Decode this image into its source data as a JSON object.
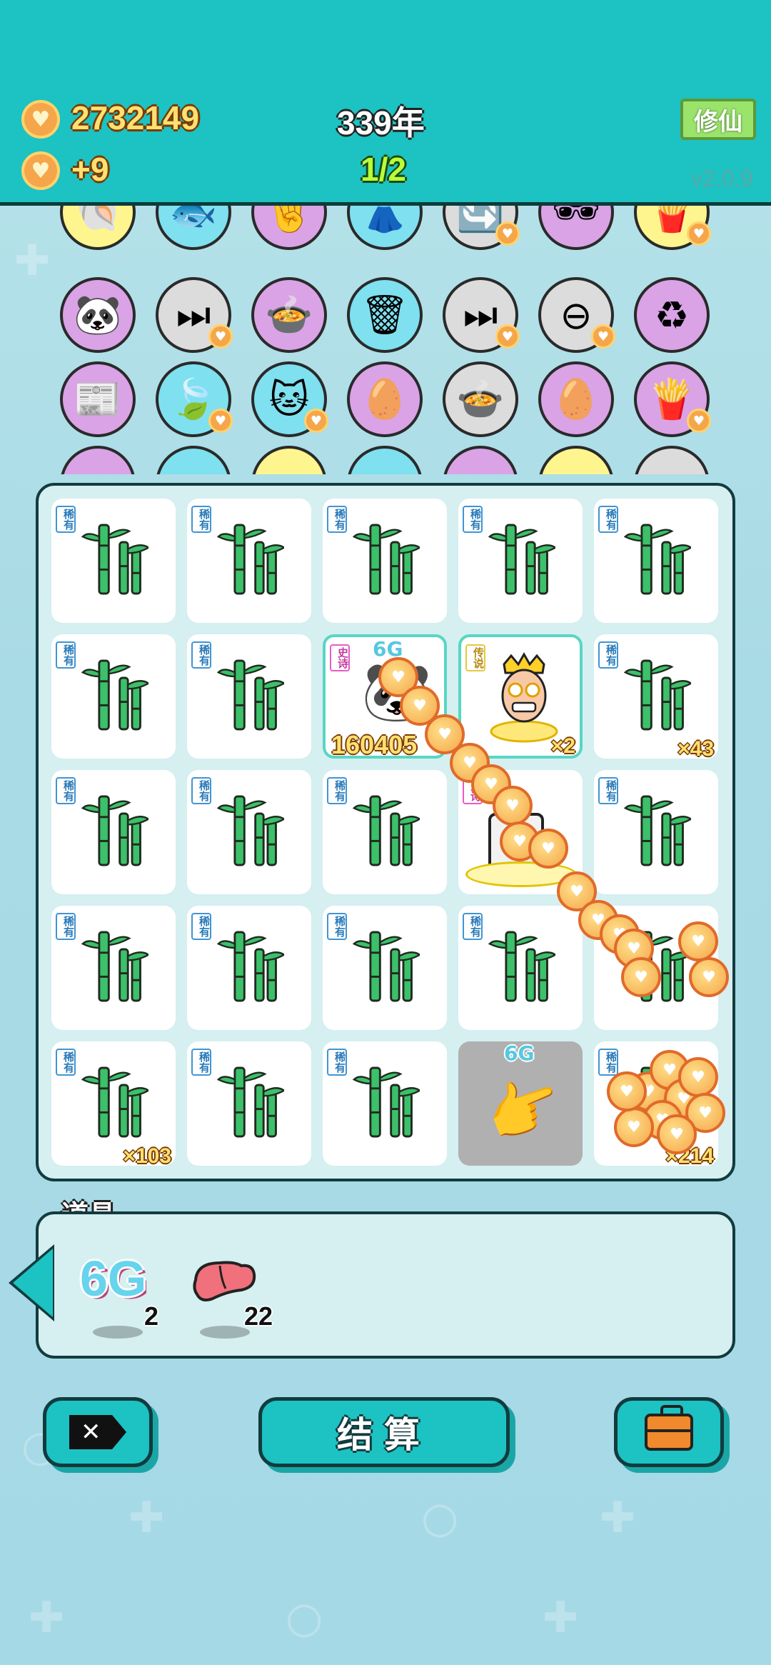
{
  "header": {
    "coins": "2732149",
    "coin_rate": "+9",
    "year": "339年",
    "round": "1/2",
    "xiuxian_label": "修仙",
    "version": "v2.0.9"
  },
  "pool": {
    "symbols": [
      "shell-icon",
      "fishbowl-icon",
      "rock-hand-icon",
      "skirt-icon",
      "recycle-refresh-icon",
      "sunglasses-icon",
      "fries-icon",
      "panda-icon",
      "skip-icon",
      "pot-duck-icon",
      "garbage-bag-icon",
      "skip-icon",
      "minus-icon",
      "recycle-icon",
      "time-magazine-icon",
      "leaf-icon",
      "cat-icon",
      "egg-icon",
      "pot-duck-icon",
      "egg-icon",
      "fries-icon"
    ]
  },
  "board": {
    "rarity_rare": "稀有",
    "rarity_epic": "史诗",
    "rarity_legend": "传说",
    "sixg_label": "6G",
    "epic_value": "160405",
    "king_count": "×2",
    "count_r2c5": "×43",
    "count_r5c1": "×103",
    "count_r5c5": "×214"
  },
  "items": {
    "title": "道具",
    "sixg_label": "6G",
    "sixg_count": "2",
    "liver_count": "22"
  },
  "buttons": {
    "settle_label": "结算"
  },
  "colors": {
    "header_bg": "#1dc2c2",
    "accent_coin": "#ffe073",
    "board_bg": "#d6eff0"
  }
}
